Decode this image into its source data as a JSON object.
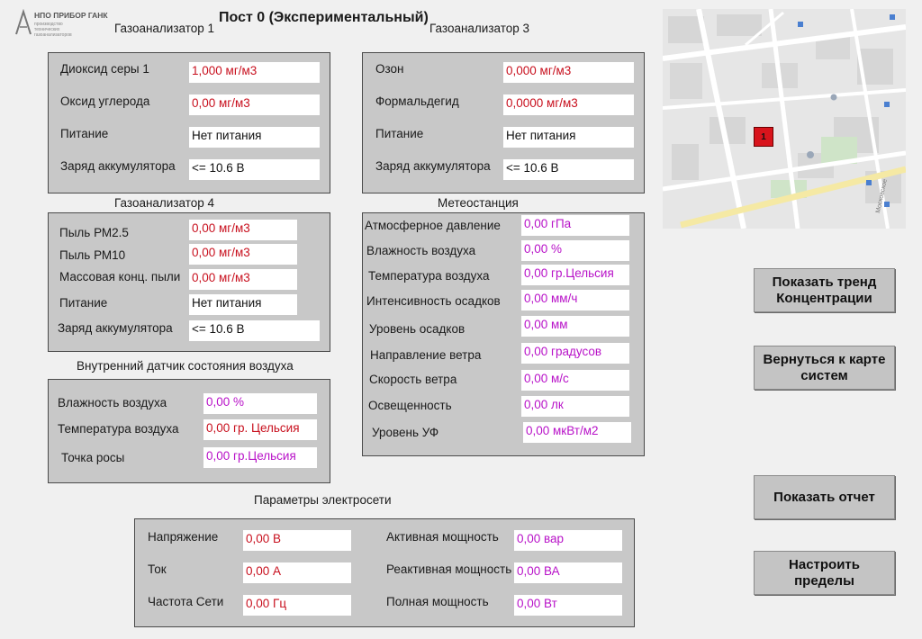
{
  "header": {
    "logo_text": "НПО ПРИБОР ГАНК",
    "logo_subtext": "производство технических газоанализаторов",
    "page_title": "Пост 0 (Экспериментальный)"
  },
  "ga1": {
    "title": "Газоанализатор 1",
    "rows": [
      {
        "label": "Диоксид серы 1",
        "value": "1,000 мг/м3"
      },
      {
        "label": "Оксид углерода",
        "value": "0,00 мг/м3"
      },
      {
        "label": "Питание",
        "value": "Нет питания"
      },
      {
        "label": "Заряд аккумулятора",
        "value": "<=  10.6 В"
      }
    ]
  },
  "ga3": {
    "title": "Газоанализатор 3",
    "rows": [
      {
        "label": "Озон",
        "value": "0,000 мг/м3"
      },
      {
        "label": "Формальдегид",
        "value": "0,0000 мг/м3"
      },
      {
        "label": "Питание",
        "value": "Нет питания"
      },
      {
        "label": "Заряд аккумулятора",
        "value": "<=  10.6 В"
      }
    ]
  },
  "ga4": {
    "title": "Газоанализатор 4",
    "rows": [
      {
        "label": "Пыль РМ2.5",
        "value": "0,00 мг/м3"
      },
      {
        "label": "Пыль РМ10",
        "value": "0,00 мг/м3"
      },
      {
        "label": "Массовая конц. пыли",
        "value": "0,00 мг/м3"
      },
      {
        "label": "Питание",
        "value": "Нет питания"
      },
      {
        "label": "Заряд аккумулятора",
        "value": "<=  10.6 В"
      }
    ]
  },
  "internal": {
    "title": "Внутренний датчик состояния воздуха",
    "rows": [
      {
        "label": "Влажность воздуха",
        "value": "0,00 %"
      },
      {
        "label": "Температура воздуха",
        "value": "0,00 гр. Цельсия"
      },
      {
        "label": "Точка росы",
        "value": "0,00 гр.Цельсия"
      }
    ]
  },
  "meteo": {
    "title": "Метеостанция",
    "rows": [
      {
        "label": "Атмосферное давление",
        "value": "0,00 гПа"
      },
      {
        "label": "Влажность воздуха",
        "value": "0,00 %"
      },
      {
        "label": "Температура воздуха",
        "value": "0,00 гр.Цельсия"
      },
      {
        "label": "Интенсивность осадков",
        "value": "0,00 мм/ч"
      },
      {
        "label": "Уровень осадков",
        "value": "0,00 мм"
      },
      {
        "label": "Направление ветра",
        "value": "0,00 градусов"
      },
      {
        "label": "Скорость ветра",
        "value": "0,00 м/с"
      },
      {
        "label": "Освещенность",
        "value": "0,00 лк"
      },
      {
        "label": "Уровень УФ",
        "value": "0,00 мкВт/м2"
      }
    ]
  },
  "power": {
    "title": "Параметры электросети",
    "left": [
      {
        "label": "Напряжение",
        "value": "0,00 В"
      },
      {
        "label": "Ток",
        "value": "0,00 А"
      },
      {
        "label": "Частота Сети",
        "value": "0,00 Гц"
      }
    ],
    "right": [
      {
        "label": "Активная мощность",
        "value": "0,00 вар"
      },
      {
        "label": "Реактивная мощность",
        "value": "0,00 ВА"
      },
      {
        "label": "Полная мощность",
        "value": "0,00 Вт"
      }
    ]
  },
  "map": {
    "marker_label": "1",
    "street_label": "Московское"
  },
  "buttons": {
    "trend": "Показать тренд Концентрации",
    "back_to_map": "Вернуться к карте систем",
    "report": "Показать отчет",
    "limits": "Настроить пределы"
  },
  "colors": {
    "panel_bg": "#c8c8c8",
    "value_red": "#c8101e",
    "value_magenta": "#b812c8",
    "marker": "#d8141c"
  }
}
